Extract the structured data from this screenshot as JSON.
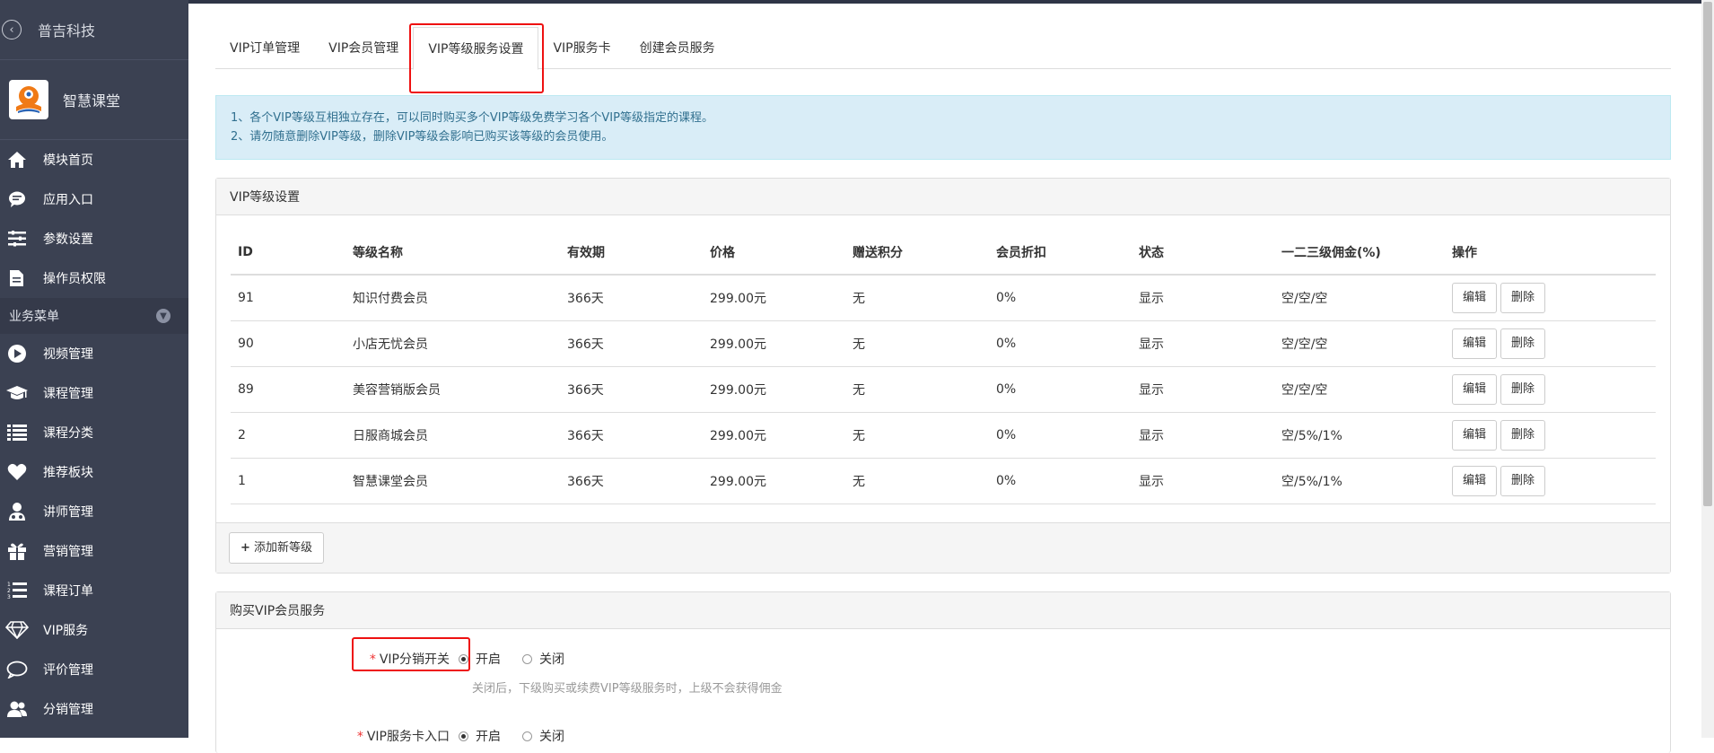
{
  "company": "普吉科技",
  "brand": "智慧课堂",
  "menu_top": [
    {
      "icon": "home-icon",
      "label": "模块首页"
    },
    {
      "icon": "chat-icon",
      "label": "应用入口"
    },
    {
      "icon": "sliders-icon",
      "label": "参数设置"
    },
    {
      "icon": "document-icon",
      "label": "操作员权限"
    }
  ],
  "group_title": "业务菜单",
  "menu_business": [
    {
      "icon": "play-icon",
      "label": "视频管理"
    },
    {
      "icon": "graduation-cap-icon",
      "label": "课程管理"
    },
    {
      "icon": "list-icon",
      "label": "课程分类"
    },
    {
      "icon": "heart-icon",
      "label": "推荐板块"
    },
    {
      "icon": "teacher-icon",
      "label": "讲师管理"
    },
    {
      "icon": "gift-icon",
      "label": "营销管理"
    },
    {
      "icon": "ordered-list-icon",
      "label": "课程订单"
    },
    {
      "icon": "diamond-icon",
      "label": "VIP服务"
    },
    {
      "icon": "comment-icon",
      "label": "评价管理"
    },
    {
      "icon": "users-icon",
      "label": "分销管理"
    }
  ],
  "tabs": [
    "VIP订单管理",
    "VIP会员管理",
    "VIP等级服务设置",
    "VIP服务卡",
    "创建会员服务"
  ],
  "alert": {
    "line1": "1、各个VIP等级互相独立存在，可以同时购买多个VIP等级免费学习各个VIP等级指定的课程。",
    "line2": "2、请勿随意删除VIP等级，删除VIP等级会影响已购买该等级的会员使用。"
  },
  "levels_panel": {
    "title": "VIP等级设置",
    "headers": [
      "ID",
      "等级名称",
      "有效期",
      "价格",
      "赠送积分",
      "会员折扣",
      "状态",
      "一二三级佣金(%)",
      "操作"
    ],
    "rows": [
      [
        "91",
        "知识付费会员",
        "366天",
        "299.00元",
        "无",
        "0%",
        "显示",
        "空/空/空"
      ],
      [
        "90",
        "小店无忧会员",
        "366天",
        "299.00元",
        "无",
        "0%",
        "显示",
        "空/空/空"
      ],
      [
        "89",
        "美容营销版会员",
        "366天",
        "299.00元",
        "无",
        "0%",
        "显示",
        "空/空/空"
      ],
      [
        "2",
        "日服商城会员",
        "366天",
        "299.00元",
        "无",
        "0%",
        "显示",
        "空/5%/1%"
      ],
      [
        "1",
        "智慧课堂会员",
        "366天",
        "299.00元",
        "无",
        "0%",
        "显示",
        "空/5%/1%"
      ]
    ],
    "edit_label": "编辑",
    "delete_label": "删除",
    "add_label": "添加新等级"
  },
  "buy_panel": {
    "title": "购买VIP会员服务",
    "dist_label": "VIP分销开关",
    "on_label": "开启",
    "off_label": "关闭",
    "dist_help": "关闭后，下级购买或续费VIP等级服务时，上级不会获得佣金",
    "card_label": "VIP服务卡入口",
    "required_mark": "*"
  }
}
